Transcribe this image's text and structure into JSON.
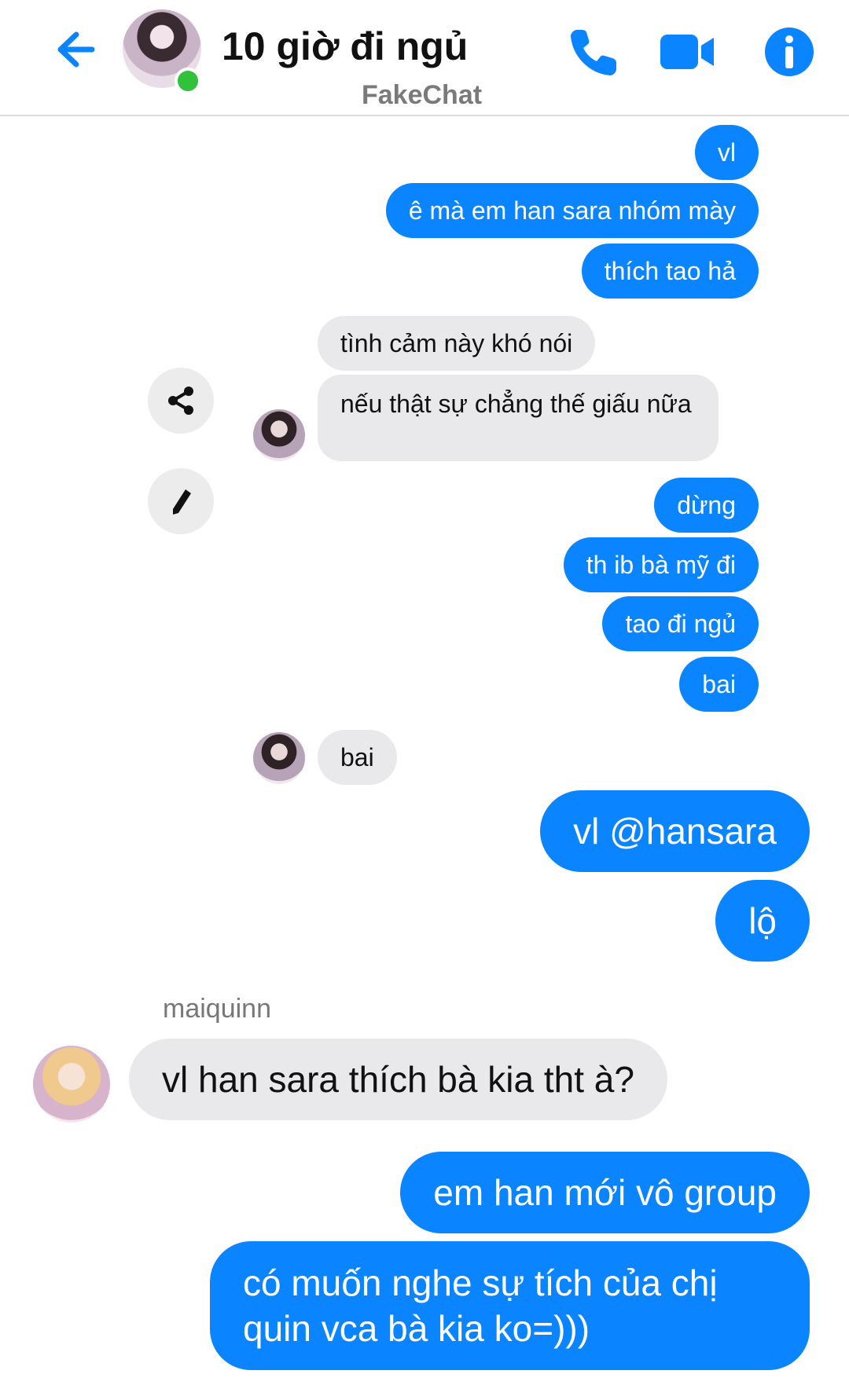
{
  "header": {
    "title": "10 giờ đi ngủ",
    "watermark": "FakeChat",
    "icons": {
      "back": "arrow-left-icon",
      "call": "phone-icon",
      "video": "video-camera-icon",
      "info": "info-icon"
    },
    "status": "online"
  },
  "colors": {
    "accent": "#0a84ff",
    "incoming_bubble": "#e9e9eb",
    "online": "#31c13a"
  },
  "messages": [
    {
      "dir": "out",
      "text": "vl"
    },
    {
      "dir": "out",
      "text": "ê mà em han sara nhóm mày"
    },
    {
      "dir": "out",
      "text": "thích tao hả"
    },
    {
      "dir": "in",
      "text": "tình cảm này khó nói"
    },
    {
      "dir": "in",
      "text": "nếu thật sự chẳng thế giấu nữa"
    },
    {
      "dir": "out",
      "text": "dừng"
    },
    {
      "dir": "out",
      "text": "th ib bà mỹ đi"
    },
    {
      "dir": "out",
      "text": "tao đi ngủ"
    },
    {
      "dir": "out",
      "text": "bai"
    },
    {
      "dir": "in",
      "text": "bai"
    },
    {
      "dir": "out",
      "text": "vl @hansara"
    },
    {
      "dir": "out",
      "text": "lộ"
    },
    {
      "dir": "in",
      "sender": "maiquinn",
      "text": "vl han sara thích bà kia tht à?"
    },
    {
      "dir": "out",
      "text": "em han mới vô group"
    },
    {
      "dir": "out",
      "text": "có muốn nghe sự tích của chị quin vca bà kia ko=)))"
    }
  ],
  "actions": {
    "share": "share-icon",
    "edit": "pencil-icon"
  }
}
